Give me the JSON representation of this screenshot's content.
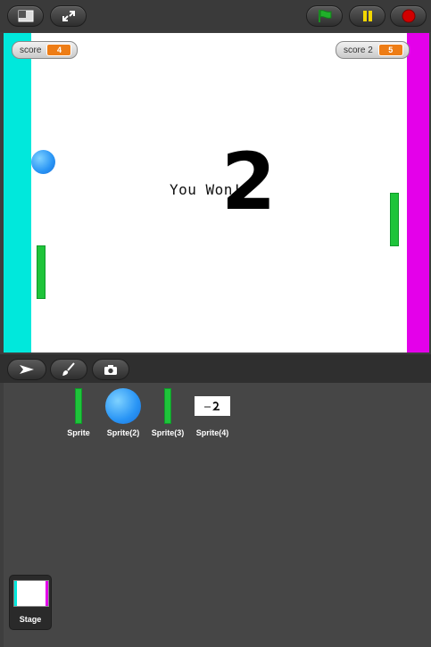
{
  "toolbar": {
    "buttons": [
      "small-stage-icon",
      "fullscreen-icon",
      "green-flag-icon",
      "pause-icon",
      "stop-icon"
    ],
    "colors": {
      "flag": "#20b02a",
      "pause": "#f2d600",
      "stop": "#d10000"
    }
  },
  "stage": {
    "monitors": [
      {
        "label": "score",
        "value": "4"
      },
      {
        "label": "score 2",
        "value": "5"
      }
    ],
    "message": "You Won!",
    "message_digit": "2",
    "colors": {
      "left_wall": "#00e8dc",
      "right_wall": "#e400ea",
      "paddle": "#1ec43a",
      "ball": "#2894f5"
    }
  },
  "modes": [
    "arrow-icon",
    "paintbrush-icon",
    "camera-icon"
  ],
  "sprites": [
    {
      "name": "Sprite",
      "thumb": "green-paddle"
    },
    {
      "name": "Sprite(2)",
      "thumb": "blue-ball"
    },
    {
      "name": "Sprite(3)",
      "thumb": "green-paddle"
    },
    {
      "name": "Sprite(4)",
      "thumb": "you-won-text"
    }
  ],
  "stage_item": {
    "label": "Stage"
  }
}
